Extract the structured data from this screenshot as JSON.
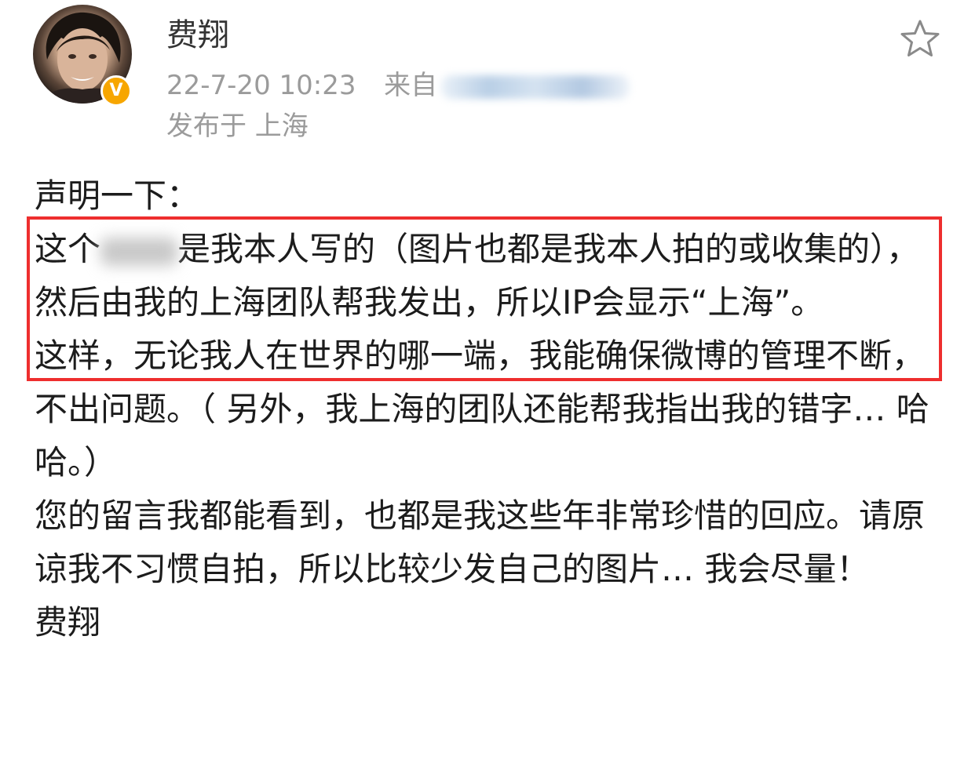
{
  "post": {
    "author": {
      "name": "费翔",
      "avatar_icon": "avatar-photo",
      "badge_icon": "verified-v-badge",
      "badge_symbol": "V",
      "badge_color": "#f7a600"
    },
    "timestamp": "22-7-20 10:23",
    "source_prefix": "来自",
    "location": "发布于 上海",
    "favorite_icon": "star-outline-icon",
    "highlight_color": "#ee2e2e",
    "content": {
      "intro": "声明一下：",
      "highlight_part1": "这个",
      "highlight_part2": "是我本人写的（图片也都是我本人拍的或收集的），然后由我的上海团队帮我发出，所以IP会显示“上海”。",
      "para2": "这样，无论我人在世界的哪一端，我能确保微博的管理不断，不出问题。（ 另外，我上海的团队还能帮我指出我的错字… 哈哈。）",
      "para3": "您的留言我都能看到，也都是我这些年非常珍惜的回应。请原谅我不习惯自拍，所以比较少发自己的图片… 我会尽量！",
      "signature": "费翔"
    }
  }
}
